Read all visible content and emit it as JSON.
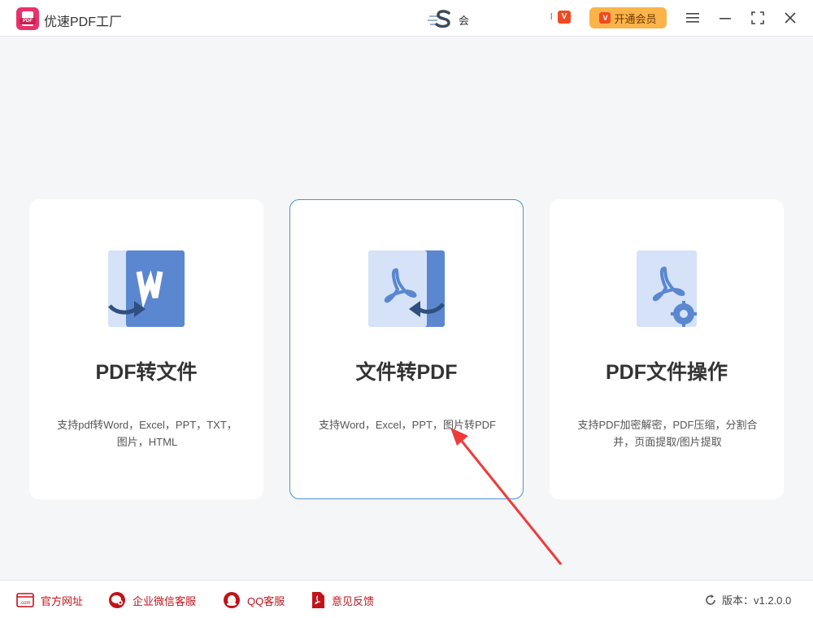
{
  "titlebar": {
    "app_title": "优速PDF工厂",
    "logo_tag": "PDF",
    "user_name": "会",
    "small_text": "l",
    "vip_badge": "V",
    "vip_button_label": "开通会员",
    "vip_button_badge": "V"
  },
  "cards": [
    {
      "title": "PDF转文件",
      "desc_line1": "支持pdf转Word，Excel，PPT，TXT，",
      "desc_line2": "图片，HTML"
    },
    {
      "title": "文件转PDF",
      "desc_line1": "支持Word，Excel，PPT，图片转PDF",
      "desc_line2": ""
    },
    {
      "title": "PDF文件操作",
      "desc_line1": "支持PDF加密解密，PDF压缩，分割合",
      "desc_line2": "并，页面提取/图片提取"
    }
  ],
  "footer": {
    "website": "官方网址",
    "website_icon_text": ".com",
    "wechat": "企业微信客服",
    "qq": "QQ客服",
    "feedback": "意见反馈",
    "version": "版本：v1.2.0.0"
  },
  "colors": {
    "brand_pink": "#e8326a",
    "accent_blue": "#4a90d9",
    "icon_blue": "#5a87d0",
    "icon_light": "#d5e2f7",
    "vip_orange": "#fbb34a",
    "footer_red": "#c0131a",
    "annotation_red": "#ef3b3b"
  }
}
